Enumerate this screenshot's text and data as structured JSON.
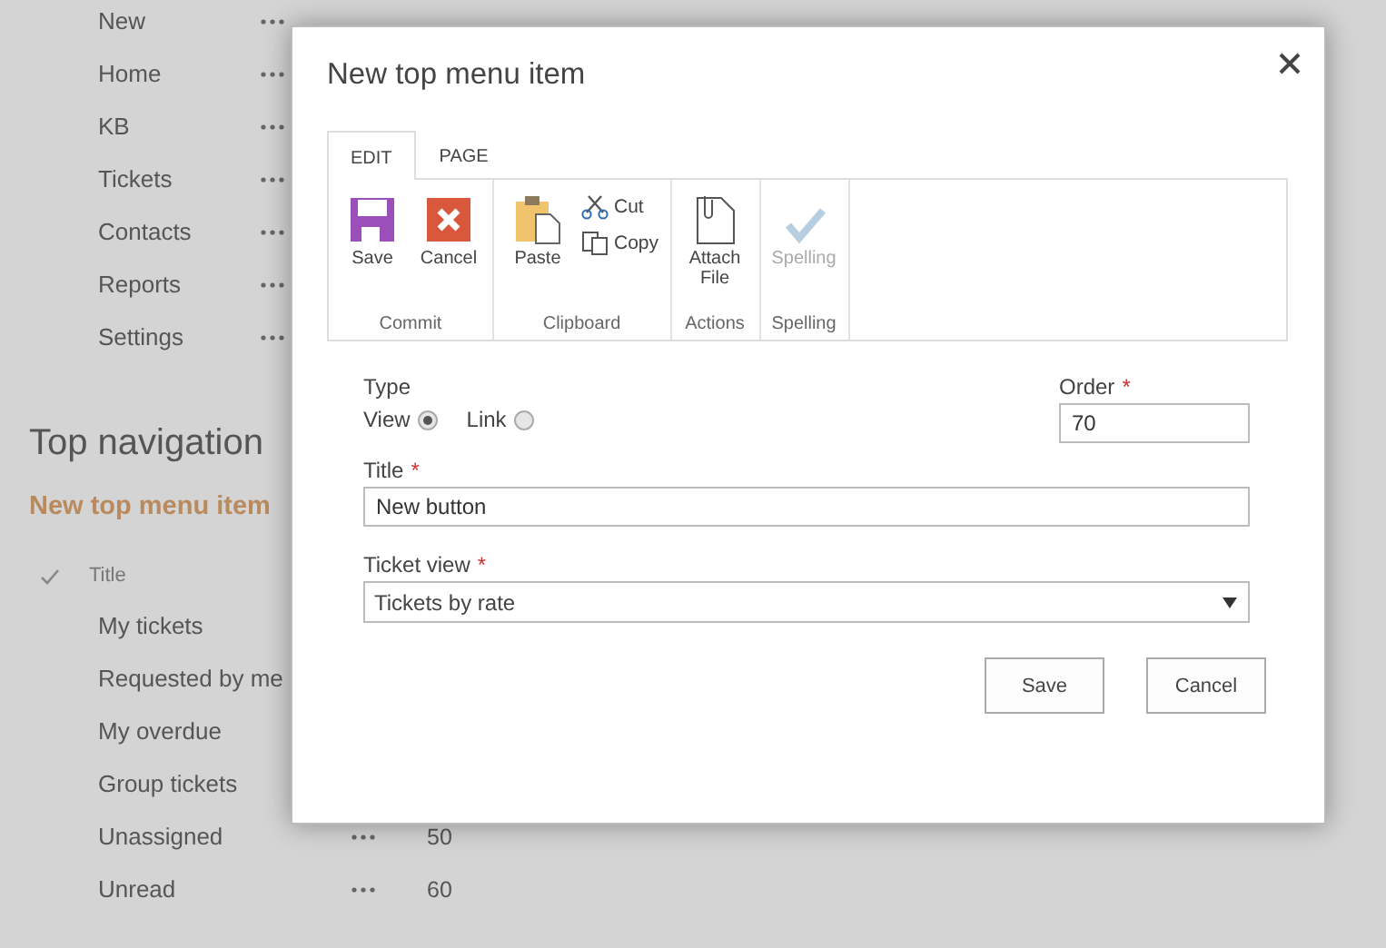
{
  "menu_items": [
    "New",
    "Home",
    "KB",
    "Tickets",
    "Contacts",
    "Reports",
    "Settings"
  ],
  "section": {
    "heading": "Top navigation",
    "link": "New top menu item"
  },
  "list": {
    "column": "Title",
    "checked": true,
    "rows": [
      {
        "title": "My tickets"
      },
      {
        "title": "Requested by me"
      },
      {
        "title": "My overdue"
      },
      {
        "title": "Group tickets"
      },
      {
        "title": "Unassigned",
        "column_3": "50"
      },
      {
        "title": "Unread",
        "column_3": "60"
      }
    ]
  },
  "dialog": {
    "title": "New top menu item",
    "tabs": [
      {
        "label": "EDIT",
        "selected": true
      },
      {
        "label": "PAGE",
        "selected": false
      }
    ],
    "groups": [
      {
        "label": "Commit",
        "disabled": false,
        "items": [
          {
            "kind": "save",
            "label": "Save"
          },
          {
            "kind": "cancel",
            "label": "Cancel"
          }
        ]
      },
      {
        "label": "Clipboard",
        "disabled": false,
        "items": [
          {
            "kind": "paste",
            "label": "Paste"
          },
          {
            "kind": "cut",
            "label": "Cut"
          },
          {
            "kind": "copy",
            "label": "Copy"
          }
        ]
      },
      {
        "label": "Actions",
        "disabled": false,
        "items": [
          {
            "kind": "attach",
            "label": "Attach File"
          }
        ]
      },
      {
        "label": "Spelling",
        "disabled": true,
        "items": [
          {
            "kind": "spelling",
            "label": "Spelling"
          }
        ]
      }
    ],
    "type": {
      "label": "Type",
      "options": [
        {
          "label": "View",
          "selected": true
        },
        {
          "label": "Link",
          "selected": false
        }
      ]
    },
    "order": {
      "label": "Order",
      "required_mark": "*",
      "value": "70"
    },
    "title_field": {
      "label": "Title",
      "required_mark": "*",
      "value": "New button"
    },
    "ticket_view": {
      "label": "Ticket view",
      "required_mark": "*",
      "value": "Tickets by rate"
    },
    "buttons": [
      "Save",
      "Cancel"
    ]
  }
}
